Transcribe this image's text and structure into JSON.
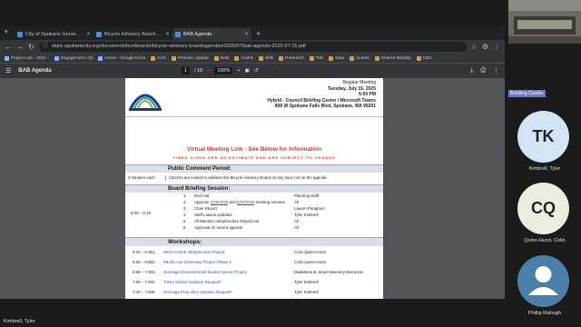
{
  "browser": {
    "tabs": [
      {
        "label": "City of Spokane General Public",
        "active": false
      },
      {
        "label": "Bicycle Advisory Board - City o",
        "active": false
      },
      {
        "label": "BAB Agenda",
        "active": true
      }
    ],
    "new_tab": "+",
    "url": "static.spokanecity.org/documents/bcs/boards/bicycle-advisory-board/agendas/2025/07/bab-agenda-2025-07-15.pdf",
    "bookmarks": [
      {
        "label": "Project List - 2024 -",
        "folder": false
      },
      {
        "label": "Engagement HQ",
        "folder": false
      },
      {
        "label": "Home - Google Drive",
        "folder": false
      },
      {
        "label": "CoS",
        "folder": true
      },
      {
        "label": "Periodic Update",
        "folder": true
      },
      {
        "label": "BAB",
        "folder": true
      },
      {
        "label": "Codes",
        "folder": true
      },
      {
        "label": "Bills",
        "folder": true
      },
      {
        "label": "Research",
        "folder": true
      },
      {
        "label": "ToD",
        "folder": true
      },
      {
        "label": "Data",
        "folder": true
      },
      {
        "label": "Grants",
        "folder": true
      },
      {
        "label": "Shared Mobility",
        "folder": true
      },
      {
        "label": "CBC",
        "folder": true
      }
    ]
  },
  "pdf": {
    "title": "BAB Agenda",
    "page_current": "1",
    "page_total": "/ 10",
    "zoom": "100%",
    "minus": "–",
    "plus": "+"
  },
  "doc": {
    "meeting": [
      "Regular Meeting",
      "Tuesday, July 15, 2025",
      "6:00 PM",
      "Hybrid - Council Briefing Center / Microsoft Teams",
      "808 W Spokane Falls Blvd, Spokane, WA 99201"
    ],
    "virtual_link": "Virtual Meeting Link - See Below for Information",
    "times_note": "TIMES GIVEN ARE AN ESTIMATE AND ARE SUBJECT TO CHANGE",
    "public_comment": {
      "heading": "Public Comment Period:",
      "time": "3 minutes each",
      "text": "Citizens are invited to address the Bicycle Advisory Board on any topic not on the agenda."
    },
    "briefing": {
      "heading": "Board Briefing Session:",
      "time": "6:00 – 6:15",
      "items": [
        {
          "n": "1.",
          "pre": "Roll Call",
          "l1": "",
          "mid": "",
          "l2": "",
          "post": "",
          "who": "Planning Staff"
        },
        {
          "n": "2.",
          "pre": "Approve ",
          "l1": "4/15/2025",
          "mid": " and ",
          "l2": "5/20/2025",
          "post": " meeting minutes",
          "who": "All"
        },
        {
          "n": "3.",
          "pre": "Chair Report",
          "l1": "",
          "mid": "",
          "l2": "",
          "post": "",
          "who": "Lauren Pangborn"
        },
        {
          "n": "4.",
          "pre": "Staff Liaison Updates",
          "l1": "",
          "mid": "",
          "l2": "",
          "post": "",
          "who": "Tyler Kimbrell"
        },
        {
          "n": "5.",
          "pre": "All Member Infrastructure Report-out",
          "l1": "",
          "mid": "",
          "l2": "",
          "post": "",
          "who": "All"
        },
        {
          "n": "6.",
          "pre": "Approval of current agenda",
          "l1": "",
          "mid": "",
          "l2": "",
          "post": "",
          "who": "All"
        }
      ]
    },
    "workshops": {
      "heading": "Workshops:",
      "items": [
        {
          "time": "6:15 – 6:35",
          "n": "1.",
          "title": "West Central Infrastructure Project",
          "who": "Colin Quinn-Hurst"
        },
        {
          "time": "6:35 – 6:55",
          "n": "2.",
          "title": "Pacific Ave Greenway Project Phase 2",
          "who": "Colin Quinn-Hurst"
        },
        {
          "time": "6:55 – 7:30",
          "n": "3.",
          "title": "Gonzaga Environmental Studies Senior Project",
          "who": "Madeleine & Jered Sweeney-Demezas"
        },
        {
          "time": "7:30 – 7:40",
          "n": "4.",
          "title": "Trinity School Vacation Request*",
          "who": "Tyler Kimbrell"
        },
        {
          "time": "7:40 – 7:50",
          "n": "5.",
          "title": "Gonzaga Prep Alley Vacation Request*",
          "who": "Tyler Kimbrell"
        }
      ]
    }
  },
  "participants": {
    "room_label": "Briefing Center",
    "people": [
      {
        "initials": "TK",
        "name": "Kimbrell, Tyler",
        "color": "#d3e4f5"
      },
      {
        "initials": "CQ",
        "name": "Quinn-Hurst, Colin",
        "color": "#e8efe0"
      },
      {
        "initials": "",
        "name": "Phillip Mahugh",
        "color": "#4a7fa8"
      }
    ]
  },
  "presenter": "Kimbrell, Tyler"
}
